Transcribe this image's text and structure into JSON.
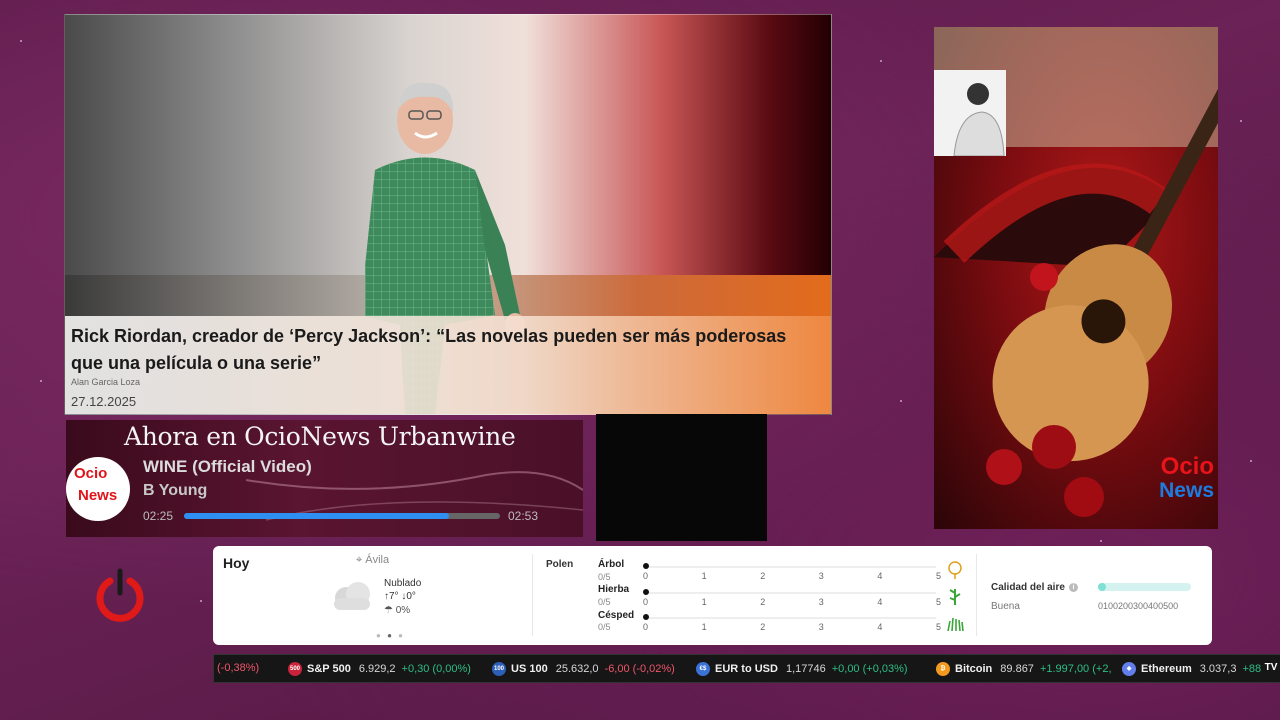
{
  "hero": {
    "title": "Rick Riordan, creador de ‘Percy Jackson’: “Las novelas pueden ser más poderosas que una película o una serie”",
    "author": "Alan Garcia Loza",
    "date": "27.12.2025"
  },
  "now_playing": {
    "header": "Ahora en OcioNews Urbanwine",
    "logo_text_top": "Ocio",
    "logo_text_bottom": "News",
    "title": "WINE (Official Video)",
    "artist": "B Young",
    "current_time": "02:25",
    "total_time": "02:53",
    "progress_fraction": 0.84,
    "accent_color": "#2e8ff0"
  },
  "poster": {
    "brand_top": "Ocio",
    "brand_bottom": "News"
  },
  "power": {
    "icon": "power-icon",
    "color": "#e01919"
  },
  "weather": {
    "today_label": "Hoy",
    "location": "Ávila",
    "condition": "Nublado",
    "temp_high": "7°",
    "temp_low": "0°",
    "precip": "0%",
    "pollen_label": "Polen",
    "pollen": [
      {
        "label": "Árbol",
        "score": "0/5",
        "icon": "tree-icon",
        "color": "#e0a020"
      },
      {
        "label": "Hierba",
        "score": "0/5",
        "icon": "weed-icon",
        "color": "#3aa63a"
      },
      {
        "label": "Césped",
        "score": "0/5",
        "icon": "grass-icon",
        "color": "#3aa63a"
      }
    ],
    "scale_ticks": [
      "0",
      "1",
      "2",
      "3",
      "4",
      "5"
    ],
    "air_quality_label": "Calidad del aire",
    "air_quality_value": "Buena",
    "air_quality_scale": "0100200300400500"
  },
  "ticker": [
    {
      "name": "",
      "price": "",
      "change": "(-0,38%)",
      "dir": "dn",
      "icon": "",
      "color": ""
    },
    {
      "name": "S&P 500",
      "price": "6.929,2",
      "change": "+0,30 (0,00%)",
      "dir": "up",
      "icon": "500",
      "color": "#c8233a"
    },
    {
      "name": "US 100",
      "price": "25.632,0",
      "change": "-6,00 (-0,02%)",
      "dir": "dn",
      "icon": "100",
      "color": "#2b5fb8"
    },
    {
      "name": "EUR to USD",
      "price": "1,17746",
      "change": "+0,00 (+0,03%)",
      "dir": "up",
      "icon": "€$",
      "color": "#3a72d6"
    },
    {
      "name": "Bitcoin",
      "price": "89.867",
      "change": "+1.997,00 (+2,",
      "dir": "up",
      "icon": "₿",
      "color": "#f39a1e"
    },
    {
      "name": "Ethereum",
      "price": "3.037,3",
      "change": "+88",
      "dir": "up",
      "icon": "◆",
      "color": "#627eea"
    }
  ],
  "ticker_brand": "TV"
}
